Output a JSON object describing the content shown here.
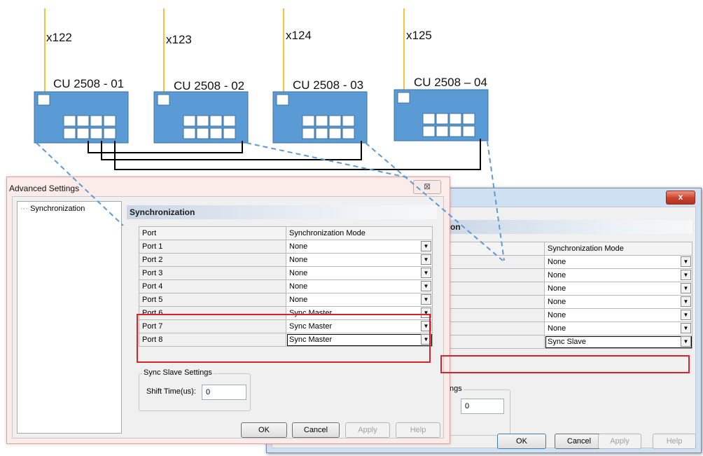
{
  "devices": [
    {
      "label": "CU 2508 - 01",
      "cable": "x122"
    },
    {
      "label": "CU 2508 - 02",
      "cable": "x123"
    },
    {
      "label": "CU 2508 - 03",
      "cable": "x124"
    },
    {
      "label": "CU 2508 – 04",
      "cable": "x125"
    }
  ],
  "colors": {
    "device_fill": "#5b9bd5",
    "device_stroke": "#41719c",
    "cable": "#f5c33b",
    "link": "#000000",
    "dash": "#5b9bd5",
    "highlight": "#d9232a"
  },
  "left_dialog": {
    "title": "Advanced Settings",
    "close_glyph": "⊠",
    "tree_item": "Synchronization",
    "section": "Synchronization",
    "header": {
      "port": "Port",
      "mode": "Synchronization Mode"
    },
    "rows": [
      {
        "port": "Port 1",
        "mode": "None"
      },
      {
        "port": "Port 2",
        "mode": "None"
      },
      {
        "port": "Port 3",
        "mode": "None"
      },
      {
        "port": "Port 4",
        "mode": "None"
      },
      {
        "port": "Port 5",
        "mode": "None"
      },
      {
        "port": "Port 6",
        "mode": "Sync Master"
      },
      {
        "port": "Port 7",
        "mode": "Sync Master"
      },
      {
        "port": "Port 8",
        "mode": "Sync Master"
      }
    ],
    "group_title": "Sync Slave Settings",
    "shift_label": "Shift Time(us):",
    "shift_value": "0",
    "buttons": {
      "ok": "OK",
      "cancel": "Cancel",
      "apply": "Apply",
      "help": "Help"
    }
  },
  "right_dialog": {
    "close_glyph": "x",
    "section_fragment": "on",
    "header": {
      "mode": "Synchronization Mode"
    },
    "rows": [
      {
        "mode": "None"
      },
      {
        "mode": "None"
      },
      {
        "mode": "None"
      },
      {
        "mode": "None"
      },
      {
        "mode": "None"
      },
      {
        "mode": "None"
      },
      {
        "mode": "Sync Slave"
      }
    ],
    "group_fragment": "ngs",
    "shift_value": "0",
    "buttons": {
      "ok": "OK",
      "cancel": "Cancel",
      "apply": "Apply",
      "help": "Help"
    }
  }
}
